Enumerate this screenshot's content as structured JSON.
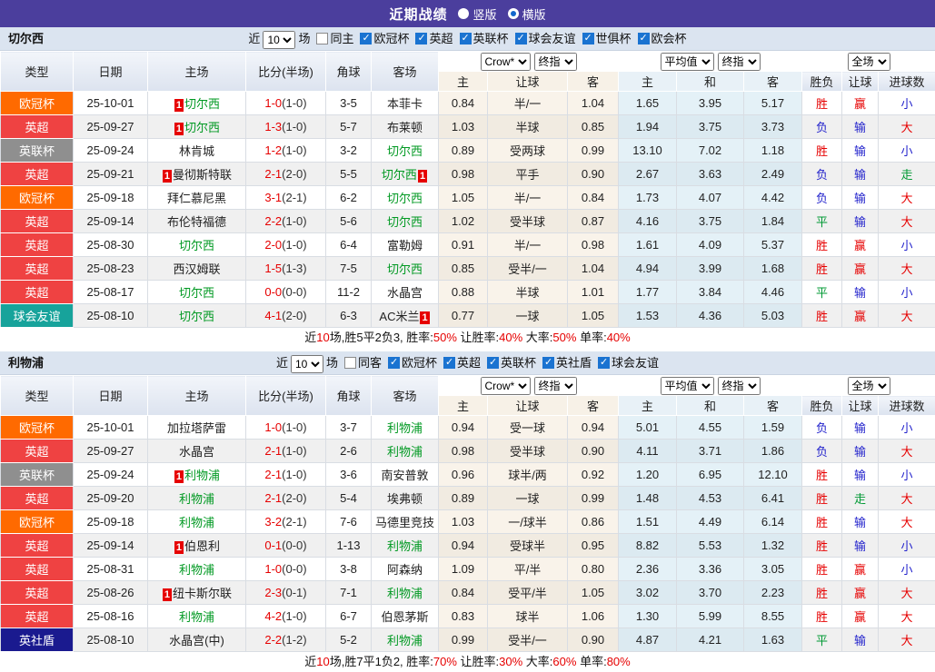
{
  "title_bar": {
    "title": "近期战绩",
    "radios": [
      {
        "label": "竖版",
        "selected": false
      },
      {
        "label": "横版",
        "selected": true
      }
    ]
  },
  "colors": {
    "titlebar_bg": "#4b3e9d",
    "radio_dot": "#1266cc",
    "self_team_green": "#009922",
    "score_red": "#e60000",
    "badge_red": "#e60000",
    "crow_column_bg": "#f9f3ea",
    "avg_column_bg": "#e4f1f7",
    "type_colors": {
      "欧冠杯": "#ff6a00",
      "英超": "#ef4242",
      "英联杯": "#8f8f8f",
      "球会友谊": "#17a39b",
      "英社盾": "#1a1a8f"
    },
    "outcome_colors": {
      "胜": "#e60000",
      "负": "#2323cc",
      "平": "#009933",
      "赢": "#e60000",
      "输": "#2323cc",
      "走": "#009933",
      "大": "#e60000",
      "小": "#2323cc"
    }
  },
  "sections": [
    {
      "team": "切尔西",
      "filter": {
        "near": "近",
        "count": "10",
        "games": "场",
        "same": {
          "label": "同主",
          "checked": false
        },
        "cups": [
          {
            "label": "欧冠杯",
            "checked": true
          },
          {
            "label": "英超",
            "checked": true
          },
          {
            "label": "英联杯",
            "checked": true
          },
          {
            "label": "球会友谊",
            "checked": true
          },
          {
            "label": "世俱杯",
            "checked": true
          },
          {
            "label": "欧会杯",
            "checked": true
          }
        ]
      },
      "header": {
        "base_cols": [
          "类型",
          "日期",
          "主场",
          "比分(半场)",
          "角球",
          "客场"
        ],
        "groups": [
          {
            "selects": [
              "Crow*",
              "终指"
            ],
            "cols": [
              "主",
              "让球",
              "客"
            ],
            "tint": "crow"
          },
          {
            "selects": [
              "平均值",
              "终指"
            ],
            "cols": [
              "主",
              "和",
              "客"
            ],
            "tint": "avg"
          },
          {
            "selects": [
              "全场"
            ],
            "cols": [
              "胜负",
              "让球",
              "进球数"
            ],
            "tint": "none"
          }
        ]
      },
      "rows": [
        {
          "type": "欧冠杯",
          "date": "25-10-01",
          "home": {
            "name": "切尔西",
            "self": true,
            "badge": "1",
            "badge_pos": "before"
          },
          "score": {
            "ft": "1-0",
            "ht": "(1-0)"
          },
          "corners": "3-5",
          "away": {
            "name": "本菲卡",
            "self": false
          },
          "odds": [
            "0.84",
            "半/一",
            "1.04"
          ],
          "avg": [
            "1.65",
            "3.95",
            "5.17"
          ],
          "results": [
            "胜",
            "赢",
            "小"
          ]
        },
        {
          "type": "英超",
          "date": "25-09-27",
          "home": {
            "name": "切尔西",
            "self": true,
            "badge": "1",
            "badge_pos": "before"
          },
          "score": {
            "ft": "1-3",
            "ht": "(1-0)"
          },
          "corners": "5-7",
          "away": {
            "name": "布莱顿",
            "self": false
          },
          "odds": [
            "1.03",
            "半球",
            "0.85"
          ],
          "avg": [
            "1.94",
            "3.75",
            "3.73"
          ],
          "results": [
            "负",
            "输",
            "大"
          ]
        },
        {
          "type": "英联杯",
          "date": "25-09-24",
          "home": {
            "name": "林肯城",
            "self": false
          },
          "score": {
            "ft": "1-2",
            "ht": "(1-0)"
          },
          "corners": "3-2",
          "away": {
            "name": "切尔西",
            "self": true
          },
          "odds": [
            "0.89",
            "受两球",
            "0.99"
          ],
          "avg": [
            "13.10",
            "7.02",
            "1.18"
          ],
          "results": [
            "胜",
            "输",
            "小"
          ]
        },
        {
          "type": "英超",
          "date": "25-09-21",
          "home": {
            "name": "曼彻斯特联",
            "self": false,
            "badge": "1",
            "badge_pos": "before"
          },
          "score": {
            "ft": "2-1",
            "ht": "(2-0)"
          },
          "corners": "5-5",
          "away": {
            "name": "切尔西",
            "self": true,
            "badge": "1",
            "badge_pos": "after"
          },
          "odds": [
            "0.98",
            "平手",
            "0.90"
          ],
          "avg": [
            "2.67",
            "3.63",
            "2.49"
          ],
          "results": [
            "负",
            "输",
            "走"
          ]
        },
        {
          "type": "欧冠杯",
          "date": "25-09-18",
          "home": {
            "name": "拜仁慕尼黑",
            "self": false
          },
          "score": {
            "ft": "3-1",
            "ht": "(2-1)"
          },
          "corners": "6-2",
          "away": {
            "name": "切尔西",
            "self": true
          },
          "odds": [
            "1.05",
            "半/一",
            "0.84"
          ],
          "avg": [
            "1.73",
            "4.07",
            "4.42"
          ],
          "results": [
            "负",
            "输",
            "大"
          ]
        },
        {
          "type": "英超",
          "date": "25-09-14",
          "home": {
            "name": "布伦特福德",
            "self": false
          },
          "score": {
            "ft": "2-2",
            "ht": "(1-0)"
          },
          "corners": "5-6",
          "away": {
            "name": "切尔西",
            "self": true
          },
          "odds": [
            "1.02",
            "受半球",
            "0.87"
          ],
          "avg": [
            "4.16",
            "3.75",
            "1.84"
          ],
          "results": [
            "平",
            "输",
            "大"
          ]
        },
        {
          "type": "英超",
          "date": "25-08-30",
          "home": {
            "name": "切尔西",
            "self": true
          },
          "score": {
            "ft": "2-0",
            "ht": "(1-0)"
          },
          "corners": "6-4",
          "away": {
            "name": "富勒姆",
            "self": false
          },
          "odds": [
            "0.91",
            "半/一",
            "0.98"
          ],
          "avg": [
            "1.61",
            "4.09",
            "5.37"
          ],
          "results": [
            "胜",
            "赢",
            "小"
          ]
        },
        {
          "type": "英超",
          "date": "25-08-23",
          "home": {
            "name": "西汉姆联",
            "self": false
          },
          "score": {
            "ft": "1-5",
            "ht": "(1-3)"
          },
          "corners": "7-5",
          "away": {
            "name": "切尔西",
            "self": true
          },
          "odds": [
            "0.85",
            "受半/一",
            "1.04"
          ],
          "avg": [
            "4.94",
            "3.99",
            "1.68"
          ],
          "results": [
            "胜",
            "赢",
            "大"
          ]
        },
        {
          "type": "英超",
          "date": "25-08-17",
          "home": {
            "name": "切尔西",
            "self": true
          },
          "score": {
            "ft": "0-0",
            "ht": "(0-0)"
          },
          "corners": "11-2",
          "away": {
            "name": "水晶宫",
            "self": false
          },
          "odds": [
            "0.88",
            "半球",
            "1.01"
          ],
          "avg": [
            "1.77",
            "3.84",
            "4.46"
          ],
          "results": [
            "平",
            "输",
            "小"
          ]
        },
        {
          "type": "球会友谊",
          "date": "25-08-10",
          "home": {
            "name": "切尔西",
            "self": true
          },
          "score": {
            "ft": "4-1",
            "ht": "(2-0)"
          },
          "corners": "6-3",
          "away": {
            "name": "AC米兰",
            "self": false,
            "badge": "1",
            "badge_pos": "after"
          },
          "odds": [
            "0.77",
            "一球",
            "1.05"
          ],
          "avg": [
            "1.53",
            "4.36",
            "5.03"
          ],
          "results": [
            "胜",
            "赢",
            "大"
          ]
        }
      ],
      "summary": [
        {
          "text": "近"
        },
        {
          "text": "10",
          "red": true
        },
        {
          "text": "场,胜5平2负3, 胜率:"
        },
        {
          "text": "50%",
          "red": true
        },
        {
          "text": " 让胜率:"
        },
        {
          "text": "40%",
          "red": true
        },
        {
          "text": " 大率:"
        },
        {
          "text": "50%",
          "red": true
        },
        {
          "text": " 单率:"
        },
        {
          "text": "40%",
          "red": true
        }
      ]
    },
    {
      "team": "利物浦",
      "filter": {
        "near": "近",
        "count": "10",
        "games": "场",
        "same": {
          "label": "同客",
          "checked": false
        },
        "cups": [
          {
            "label": "欧冠杯",
            "checked": true
          },
          {
            "label": "英超",
            "checked": true
          },
          {
            "label": "英联杯",
            "checked": true
          },
          {
            "label": "英社盾",
            "checked": true
          },
          {
            "label": "球会友谊",
            "checked": true
          }
        ]
      },
      "header": {
        "base_cols": [
          "类型",
          "日期",
          "主场",
          "比分(半场)",
          "角球",
          "客场"
        ],
        "groups": [
          {
            "selects": [
              "Crow*",
              "终指"
            ],
            "cols": [
              "主",
              "让球",
              "客"
            ],
            "tint": "crow"
          },
          {
            "selects": [
              "平均值",
              "终指"
            ],
            "cols": [
              "主",
              "和",
              "客"
            ],
            "tint": "avg"
          },
          {
            "selects": [
              "全场"
            ],
            "cols": [
              "胜负",
              "让球",
              "进球数"
            ],
            "tint": "none"
          }
        ]
      },
      "rows": [
        {
          "type": "欧冠杯",
          "date": "25-10-01",
          "home": {
            "name": "加拉塔萨雷",
            "self": false
          },
          "score": {
            "ft": "1-0",
            "ht": "(1-0)"
          },
          "corners": "3-7",
          "away": {
            "name": "利物浦",
            "self": true
          },
          "odds": [
            "0.94",
            "受一球",
            "0.94"
          ],
          "avg": [
            "5.01",
            "4.55",
            "1.59"
          ],
          "results": [
            "负",
            "输",
            "小"
          ]
        },
        {
          "type": "英超",
          "date": "25-09-27",
          "home": {
            "name": "水晶宫",
            "self": false
          },
          "score": {
            "ft": "2-1",
            "ht": "(1-0)"
          },
          "corners": "2-6",
          "away": {
            "name": "利物浦",
            "self": true
          },
          "odds": [
            "0.98",
            "受半球",
            "0.90"
          ],
          "avg": [
            "4.11",
            "3.71",
            "1.86"
          ],
          "results": [
            "负",
            "输",
            "大"
          ]
        },
        {
          "type": "英联杯",
          "date": "25-09-24",
          "home": {
            "name": "利物浦",
            "self": true,
            "badge": "1",
            "badge_pos": "before"
          },
          "score": {
            "ft": "2-1",
            "ht": "(1-0)"
          },
          "corners": "3-6",
          "away": {
            "name": "南安普敦",
            "self": false
          },
          "odds": [
            "0.96",
            "球半/两",
            "0.92"
          ],
          "avg": [
            "1.20",
            "6.95",
            "12.10"
          ],
          "results": [
            "胜",
            "输",
            "小"
          ]
        },
        {
          "type": "英超",
          "date": "25-09-20",
          "home": {
            "name": "利物浦",
            "self": true
          },
          "score": {
            "ft": "2-1",
            "ht": "(2-0)"
          },
          "corners": "5-4",
          "away": {
            "name": "埃弗顿",
            "self": false
          },
          "odds": [
            "0.89",
            "一球",
            "0.99"
          ],
          "avg": [
            "1.48",
            "4.53",
            "6.41"
          ],
          "results": [
            "胜",
            "走",
            "大"
          ]
        },
        {
          "type": "欧冠杯",
          "date": "25-09-18",
          "home": {
            "name": "利物浦",
            "self": true
          },
          "score": {
            "ft": "3-2",
            "ht": "(2-1)"
          },
          "corners": "7-6",
          "away": {
            "name": "马德里竞技",
            "self": false
          },
          "odds": [
            "1.03",
            "一/球半",
            "0.86"
          ],
          "avg": [
            "1.51",
            "4.49",
            "6.14"
          ],
          "results": [
            "胜",
            "输",
            "大"
          ]
        },
        {
          "type": "英超",
          "date": "25-09-14",
          "home": {
            "name": "伯恩利",
            "self": false,
            "badge": "1",
            "badge_pos": "before"
          },
          "score": {
            "ft": "0-1",
            "ht": "(0-0)"
          },
          "corners": "1-13",
          "away": {
            "name": "利物浦",
            "self": true
          },
          "odds": [
            "0.94",
            "受球半",
            "0.95"
          ],
          "avg": [
            "8.82",
            "5.53",
            "1.32"
          ],
          "results": [
            "胜",
            "输",
            "小"
          ]
        },
        {
          "type": "英超",
          "date": "25-08-31",
          "home": {
            "name": "利物浦",
            "self": true
          },
          "score": {
            "ft": "1-0",
            "ht": "(0-0)"
          },
          "corners": "3-8",
          "away": {
            "name": "阿森纳",
            "self": false
          },
          "odds": [
            "1.09",
            "平/半",
            "0.80"
          ],
          "avg": [
            "2.36",
            "3.36",
            "3.05"
          ],
          "results": [
            "胜",
            "赢",
            "小"
          ]
        },
        {
          "type": "英超",
          "date": "25-08-26",
          "home": {
            "name": "纽卡斯尔联",
            "self": false,
            "badge": "1",
            "badge_pos": "before"
          },
          "score": {
            "ft": "2-3",
            "ht": "(0-1)"
          },
          "corners": "7-1",
          "away": {
            "name": "利物浦",
            "self": true
          },
          "odds": [
            "0.84",
            "受平/半",
            "1.05"
          ],
          "avg": [
            "3.02",
            "3.70",
            "2.23"
          ],
          "results": [
            "胜",
            "赢",
            "大"
          ]
        },
        {
          "type": "英超",
          "date": "25-08-16",
          "home": {
            "name": "利物浦",
            "self": true
          },
          "score": {
            "ft": "4-2",
            "ht": "(1-0)"
          },
          "corners": "6-7",
          "away": {
            "name": "伯恩茅斯",
            "self": false
          },
          "odds": [
            "0.83",
            "球半",
            "1.06"
          ],
          "avg": [
            "1.30",
            "5.99",
            "8.55"
          ],
          "results": [
            "胜",
            "赢",
            "大"
          ]
        },
        {
          "type": "英社盾",
          "date": "25-08-10",
          "home": {
            "name": "水晶宫(中)",
            "self": false
          },
          "score": {
            "ft": "2-2",
            "ht": "(1-2)"
          },
          "corners": "5-2",
          "away": {
            "name": "利物浦",
            "self": true
          },
          "odds": [
            "0.99",
            "受半/一",
            "0.90"
          ],
          "avg": [
            "4.87",
            "4.21",
            "1.63"
          ],
          "results": [
            "平",
            "输",
            "大"
          ]
        }
      ],
      "summary": [
        {
          "text": "近"
        },
        {
          "text": "10",
          "red": true
        },
        {
          "text": "场,胜7平1负2, 胜率:"
        },
        {
          "text": "70%",
          "red": true
        },
        {
          "text": " 让胜率:"
        },
        {
          "text": "30%",
          "red": true
        },
        {
          "text": " 大率:"
        },
        {
          "text": "60%",
          "red": true
        },
        {
          "text": " 单率:"
        },
        {
          "text": "80%",
          "red": true
        }
      ]
    }
  ]
}
